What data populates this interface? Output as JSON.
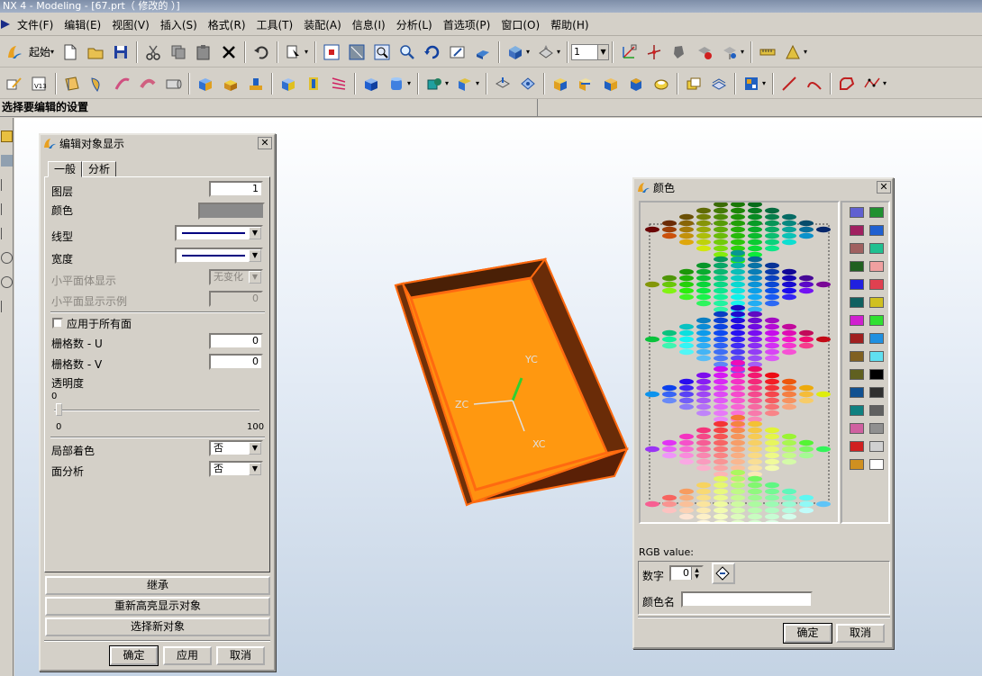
{
  "window": {
    "title": "NX 4 - Modeling - [67.prt（ 修改的 ）]"
  },
  "menu": [
    "文件(F)",
    "编辑(E)",
    "视图(V)",
    "插入(S)",
    "格式(R)",
    "工具(T)",
    "装配(A)",
    "信息(I)",
    "分析(L)",
    "首选项(P)",
    "窗口(O)",
    "帮助(H)"
  ],
  "toolbar": {
    "start_label": "起始",
    "layer_value": "1"
  },
  "status": {
    "prompt": "选择要编辑的设置"
  },
  "viewport": {
    "axis_labels": {
      "yc": "YC",
      "xc": "XC",
      "zc": "ZC"
    }
  },
  "edit_dialog": {
    "title": "编辑对象显示",
    "tabs": [
      "一般",
      "分析"
    ],
    "layer_label": "图层",
    "layer_value": "1",
    "color_label": "颜色",
    "linetype_label": "线型",
    "width_label": "宽度",
    "facet_display_label": "小平面体显示",
    "facet_display_value": "无变化",
    "facet_example_label": "小平面显示示例",
    "facet_example_value": "0",
    "apply_all_faces_label": "应用于所有面",
    "grid_u_label": "栅格数 - U",
    "grid_u_value": "0",
    "grid_v_label": "栅格数 - V",
    "grid_v_value": "0",
    "transparency_label": "透明度",
    "transparency_value": "0",
    "slider_min": "0",
    "slider_max": "100",
    "partial_shading_label": "局部着色",
    "partial_shading_value": "否",
    "face_analysis_label": "面分析",
    "face_analysis_value": "否",
    "inherit_button": "继承",
    "rehighlight_button": "重新高亮显示对象",
    "select_new_button": "选择新对象",
    "ok_button": "确定",
    "apply_button": "应用",
    "cancel_button": "取消"
  },
  "color_dialog": {
    "title": "颜色",
    "rgb_label": "RGB value:",
    "number_label": "数字",
    "number_value": "0",
    "color_name_label": "颜色名",
    "color_name_value": "",
    "ok_button": "确定",
    "cancel_button": "取消",
    "swatches": [
      "#6060d0",
      "#209030",
      "#a02060",
      "#2060d0",
      "#a06060",
      "#20c090",
      "#206020",
      "#f0a0a0",
      "#2020e0",
      "#e04050",
      "#106060",
      "#d0c020",
      "#d020d0",
      "#30e030",
      "#a02020",
      "#2090e0",
      "#806020",
      "#60e0f0",
      "#606020",
      "#000000",
      "#105090",
      "#303030",
      "#108080",
      "#606060",
      "#d060a0",
      "#909090",
      "#d02020",
      "#d0d0d0",
      "#d09020",
      "#ffffff"
    ]
  }
}
